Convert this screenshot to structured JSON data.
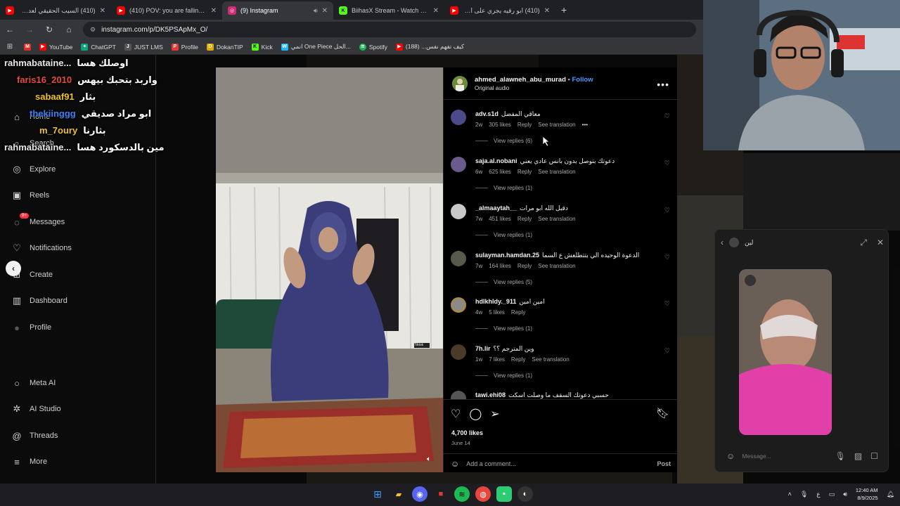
{
  "browser": {
    "tabs": [
      {
        "title": "(410) السيب الحقيقي لعدم قدرتك",
        "favicon_color": "#ff0000",
        "active": false
      },
      {
        "title": "(410) POV: you are falling in love",
        "favicon_color": "#ff0000",
        "active": false
      },
      {
        "title": "(9) Instagram",
        "favicon_color": "#d62976",
        "active": true
      },
      {
        "title": "BiihasX Stream - Watch Live on",
        "favicon_color": "#53fc18",
        "active": false
      },
      {
        "title": "(410) ابو رقيه يجري على الشاطئ",
        "favicon_color": "#ff0000",
        "active": false
      }
    ],
    "url": "instagram.com/p/DK5PSApMx_O/",
    "bookmarks": [
      {
        "label": "YouTube",
        "color": "#ff0000"
      },
      {
        "label": "ChatGPT",
        "color": "#10a37f"
      },
      {
        "label": "JUST LMS",
        "color": "#555555"
      },
      {
        "label": "Profile",
        "color": "#e53935"
      },
      {
        "label": "DokanTIP",
        "color": "#e0a800"
      },
      {
        "label": "Kick",
        "color": "#53fc18"
      },
      {
        "label": "انمي One Piece الحل...",
        "color": "#1fb6ff"
      },
      {
        "label": "Spotify",
        "color": "#1db954"
      },
      {
        "label": "كيف تفهم نفس... (188)",
        "color": "#ff0000"
      }
    ]
  },
  "sidebar": {
    "items": [
      {
        "label": "Home",
        "icon": "home-icon",
        "glyph": "⌂"
      },
      {
        "label": "Search",
        "icon": "search-icon",
        "glyph": "⌕"
      },
      {
        "label": "Explore",
        "icon": "compass-icon",
        "glyph": "◎"
      },
      {
        "label": "Reels",
        "icon": "reels-icon",
        "glyph": "▣"
      },
      {
        "label": "Messages",
        "icon": "messenger-icon",
        "glyph": "◌",
        "badge": "9+"
      },
      {
        "label": "Notifications",
        "icon": "heart-icon",
        "glyph": "♡"
      },
      {
        "label": "Create",
        "icon": "plus-square-icon",
        "glyph": "⊞"
      },
      {
        "label": "Dashboard",
        "icon": "dashboard-icon",
        "glyph": "▥"
      },
      {
        "label": "Profile",
        "icon": "avatar-icon",
        "glyph": "●"
      },
      {
        "label": "Meta AI",
        "icon": "meta-ai-icon",
        "glyph": "○"
      },
      {
        "label": "AI Studio",
        "icon": "ai-studio-icon",
        "glyph": "✲"
      },
      {
        "label": "Threads",
        "icon": "threads-icon",
        "glyph": "@"
      },
      {
        "label": "More",
        "icon": "menu-icon",
        "glyph": "≡"
      }
    ]
  },
  "stream_chat": [
    {
      "user": "rahmabataine...",
      "message": "اوصلك هسا",
      "user_color": "#e8e8e8"
    },
    {
      "user": "faris16_2010",
      "message": "واربد بتحبك بيهس",
      "user_color": "#e74c3c"
    },
    {
      "user": "sabaaf91",
      "message": "بثار",
      "user_color": "#f0c419"
    },
    {
      "user": "thekiinggg",
      "message": "ابو مراد صديقي",
      "user_color": "#3b82f6"
    },
    {
      "user": "m_7oury",
      "message": "بثارنا",
      "user_color": "#f0c419"
    },
    {
      "user": "rahmabataine...",
      "message": "مين بالدسكورد هسا",
      "user_color": "#e8e8e8"
    }
  ],
  "post": {
    "author": "ahmed_alawneh_abu_murad",
    "follow_label": "Follow",
    "audio": "Original audio",
    "video_watermark": "Tiktok",
    "comments": [
      {
        "user": "adv.s1d",
        "text": "معاقي المفضل",
        "age": "2w",
        "likes": "305 likes",
        "reply": "Reply",
        "translate": "See translation",
        "replies": "View replies (6)",
        "avatar_color": "#4b4b8a"
      },
      {
        "user": "saja.al.nobani",
        "text": "دعوتك بتوصل بدون بانس عادي يعني",
        "age": "6w",
        "likes": "625 likes",
        "reply": "Reply",
        "translate": "See translation",
        "replies": "View replies (1)",
        "avatar_color": "#6a5b8c"
      },
      {
        "user": "_almaaytah__",
        "text": "دقبل الله ابو مرات",
        "age": "7w",
        "likes": "451 likes",
        "reply": "Reply",
        "translate": "See translation",
        "replies": "View replies (1)",
        "avatar_color": "#c9c9c9"
      },
      {
        "user": "sulayman.hamdan.25",
        "text": "الدعوة الوحيده الي بتتطلعش ع السما",
        "age": "7w",
        "likes": "164 likes",
        "reply": "Reply",
        "translate": "See translation",
        "replies": "View replies (5)",
        "avatar_color": "#5a5a4a"
      },
      {
        "user": "hdlkhldy._911",
        "text": "امين امين",
        "age": "4w",
        "likes": "5 likes",
        "reply": "Reply",
        "translate": "",
        "replies": "View replies (1)",
        "avatar_color": "#b58a2e"
      },
      {
        "user": "7h.lir",
        "text": "وين المترجم ؟؟",
        "age": "1w",
        "likes": "7 likes",
        "reply": "Reply",
        "translate": "See translation",
        "replies": "View replies (1)",
        "avatar_color": "#4a3a2a"
      },
      {
        "user": "tawi.ehi08",
        "text": "حسبي دعوتك السقف ما وصلت اسكت",
        "age": "",
        "likes": "",
        "reply": "",
        "translate": "",
        "replies": "",
        "avatar_color": "#555555"
      }
    ],
    "likes": "4,700 likes",
    "date": "June 14",
    "add_comment_placeholder": "Add a comment...",
    "post_label": "Post"
  },
  "dm_popup": {
    "name": "لين",
    "placeholder": "Message..."
  },
  "taskbar": {
    "apps": [
      {
        "icon": "windows-start-icon",
        "glyph": "⊞",
        "color": "#3a9bff"
      },
      {
        "icon": "file-explorer-icon",
        "glyph": "▰",
        "color": "#f4c430"
      },
      {
        "icon": "discord-icon",
        "glyph": "◉",
        "color": "#5865f2"
      },
      {
        "icon": "recorder-icon",
        "glyph": "■",
        "color": "#e53935"
      },
      {
        "icon": "spotify-icon",
        "glyph": "≋",
        "color": "#1db954"
      },
      {
        "icon": "chrome-icon",
        "glyph": "◍",
        "color": "#e8453c"
      },
      {
        "icon": "app-icon",
        "glyph": "▪",
        "color": "#2ecc71"
      },
      {
        "icon": "obs-icon",
        "glyph": "◐",
        "color": "#444"
      }
    ],
    "language": "ع",
    "time": "12:40 AM",
    "date": "8/9/2025"
  }
}
